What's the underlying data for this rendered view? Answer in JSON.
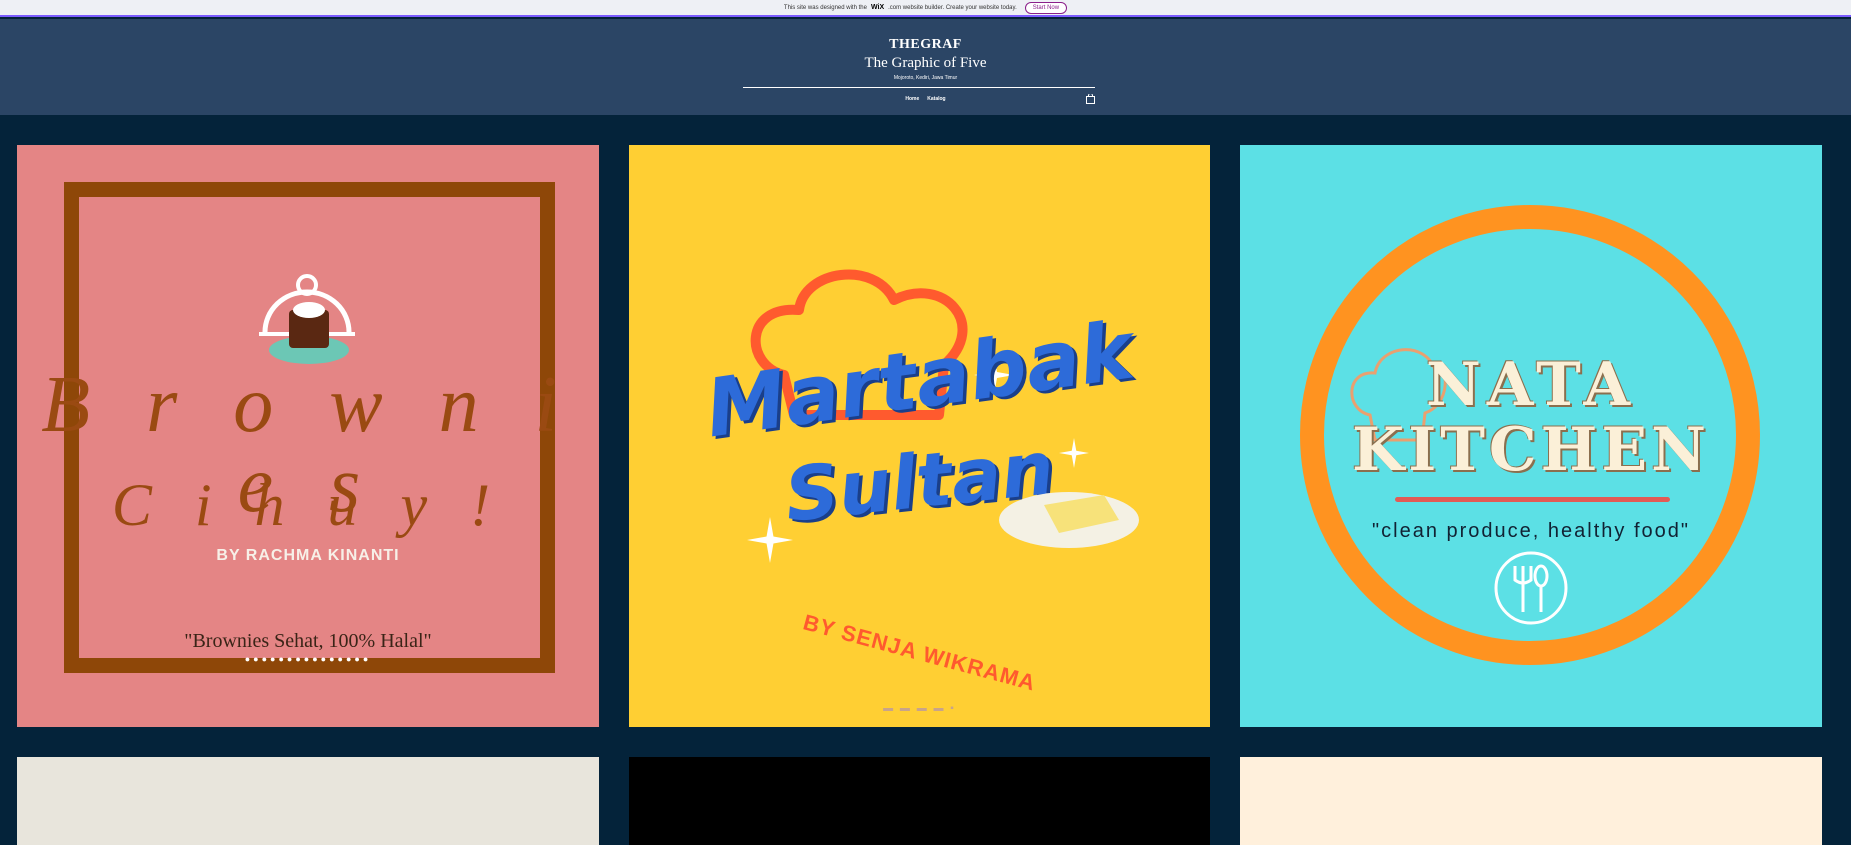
{
  "wix_banner": {
    "text_before": "This site was designed with the",
    "brand": "WiX",
    "text_after": ".com website builder. Create your website today.",
    "button_label": "Start Now"
  },
  "header": {
    "title": "THEGRAF",
    "subtitle": "The Graphic of Five",
    "location": "Mojoroto, Kediri, Jawa Timur",
    "nav": [
      "Home",
      "Katalog"
    ],
    "cart_icon": "shopping-bag-icon"
  },
  "gallery": [
    {
      "bg": "#e48585",
      "title": "B r o w n i e s",
      "title2": "C i h u y !",
      "author": "BY RACHMA KINANTI",
      "tagline": "\"Brownies Sehat, 100% Halal\"",
      "icon": "cloche-icon"
    },
    {
      "bg": "#ffcf33",
      "title": "Martabak",
      "title2": "Sultan",
      "author": "BY SENJA WIKRAMA",
      "icon": "chef-hat-icon"
    },
    {
      "bg": "#5ce0e5",
      "title": "NATA",
      "title2": "KITCHEN",
      "tagline": "\"clean produce, healthy food\"",
      "icon": "fork-spoon-icon"
    },
    {
      "bg": "#e8e5dc"
    },
    {
      "bg": "#000000"
    },
    {
      "bg": "#fff0dc"
    }
  ],
  "colors": {
    "page_bg": "#04233a",
    "header_bg": "#2b4565"
  }
}
